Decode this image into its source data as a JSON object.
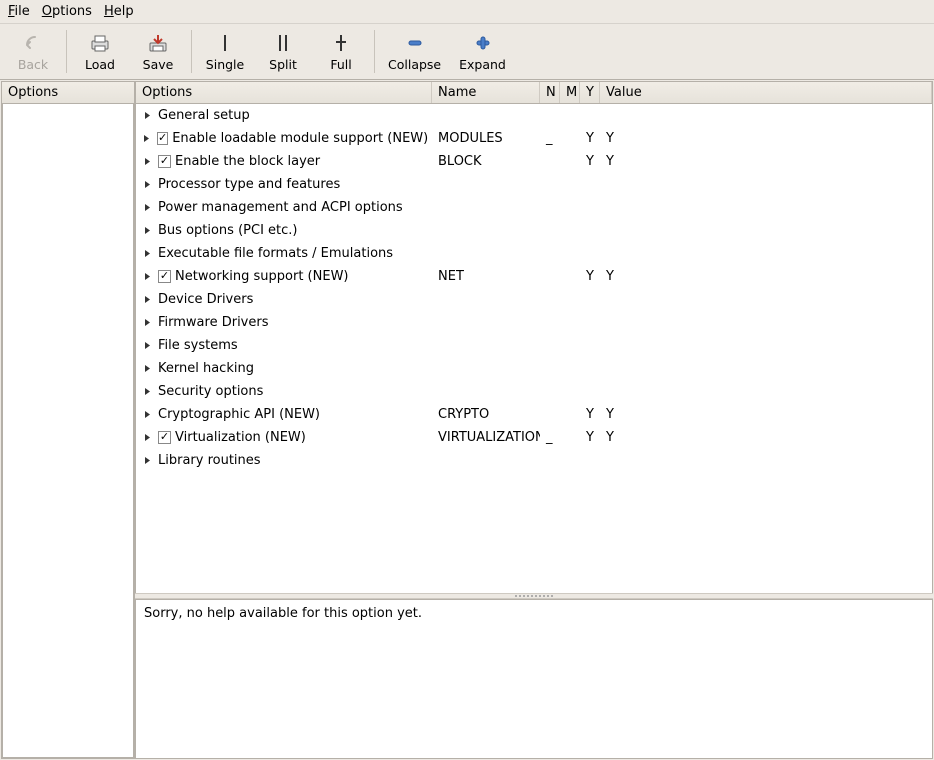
{
  "menubar": {
    "file": "File",
    "options": "Options",
    "help": "Help"
  },
  "toolbar": {
    "back": "Back",
    "load": "Load",
    "save": "Save",
    "single": "Single",
    "split": "Split",
    "full": "Full",
    "collapse": "Collapse",
    "expand": "Expand"
  },
  "left": {
    "header": "Options"
  },
  "columns": {
    "options": "Options",
    "name": "Name",
    "n": "N",
    "m": "M",
    "y": "Y",
    "value": "Value"
  },
  "rows": [
    {
      "label": "General setup",
      "checkbox": false,
      "name": "",
      "n": "",
      "m": "",
      "y": "",
      "value": ""
    },
    {
      "label": "Enable loadable module support (NEW)",
      "checkbox": true,
      "checked": true,
      "name": "MODULES",
      "n": "_",
      "m": "",
      "y": "Y",
      "value": "Y"
    },
    {
      "label": "Enable the block layer",
      "checkbox": true,
      "checked": true,
      "name": "BLOCK",
      "n": "",
      "m": "",
      "y": "Y",
      "value": "Y"
    },
    {
      "label": "Processor type and features",
      "checkbox": false,
      "name": "",
      "n": "",
      "m": "",
      "y": "",
      "value": ""
    },
    {
      "label": "Power management and ACPI options",
      "checkbox": false,
      "name": "",
      "n": "",
      "m": "",
      "y": "",
      "value": ""
    },
    {
      "label": "Bus options (PCI etc.)",
      "checkbox": false,
      "name": "",
      "n": "",
      "m": "",
      "y": "",
      "value": ""
    },
    {
      "label": "Executable file formats / Emulations",
      "checkbox": false,
      "name": "",
      "n": "",
      "m": "",
      "y": "",
      "value": ""
    },
    {
      "label": "Networking support (NEW)",
      "checkbox": true,
      "checked": true,
      "name": "NET",
      "n": "",
      "m": "",
      "y": "Y",
      "value": "Y"
    },
    {
      "label": "Device Drivers",
      "checkbox": false,
      "name": "",
      "n": "",
      "m": "",
      "y": "",
      "value": ""
    },
    {
      "label": "Firmware Drivers",
      "checkbox": false,
      "name": "",
      "n": "",
      "m": "",
      "y": "",
      "value": ""
    },
    {
      "label": "File systems",
      "checkbox": false,
      "name": "",
      "n": "",
      "m": "",
      "y": "",
      "value": ""
    },
    {
      "label": "Kernel hacking",
      "checkbox": false,
      "name": "",
      "n": "",
      "m": "",
      "y": "",
      "value": ""
    },
    {
      "label": "Security options",
      "checkbox": false,
      "name": "",
      "n": "",
      "m": "",
      "y": "",
      "value": ""
    },
    {
      "label": "Cryptographic API (NEW)",
      "checkbox": false,
      "name": "CRYPTO",
      "n": "",
      "m": "",
      "y": "Y",
      "value": "Y"
    },
    {
      "label": "Virtualization (NEW)",
      "checkbox": true,
      "checked": true,
      "name": "VIRTUALIZATION",
      "n": "_",
      "m": "",
      "y": "Y",
      "value": "Y"
    },
    {
      "label": "Library routines",
      "checkbox": false,
      "name": "",
      "n": "",
      "m": "",
      "y": "",
      "value": ""
    }
  ],
  "help": {
    "text": "Sorry, no help available for this option yet."
  }
}
